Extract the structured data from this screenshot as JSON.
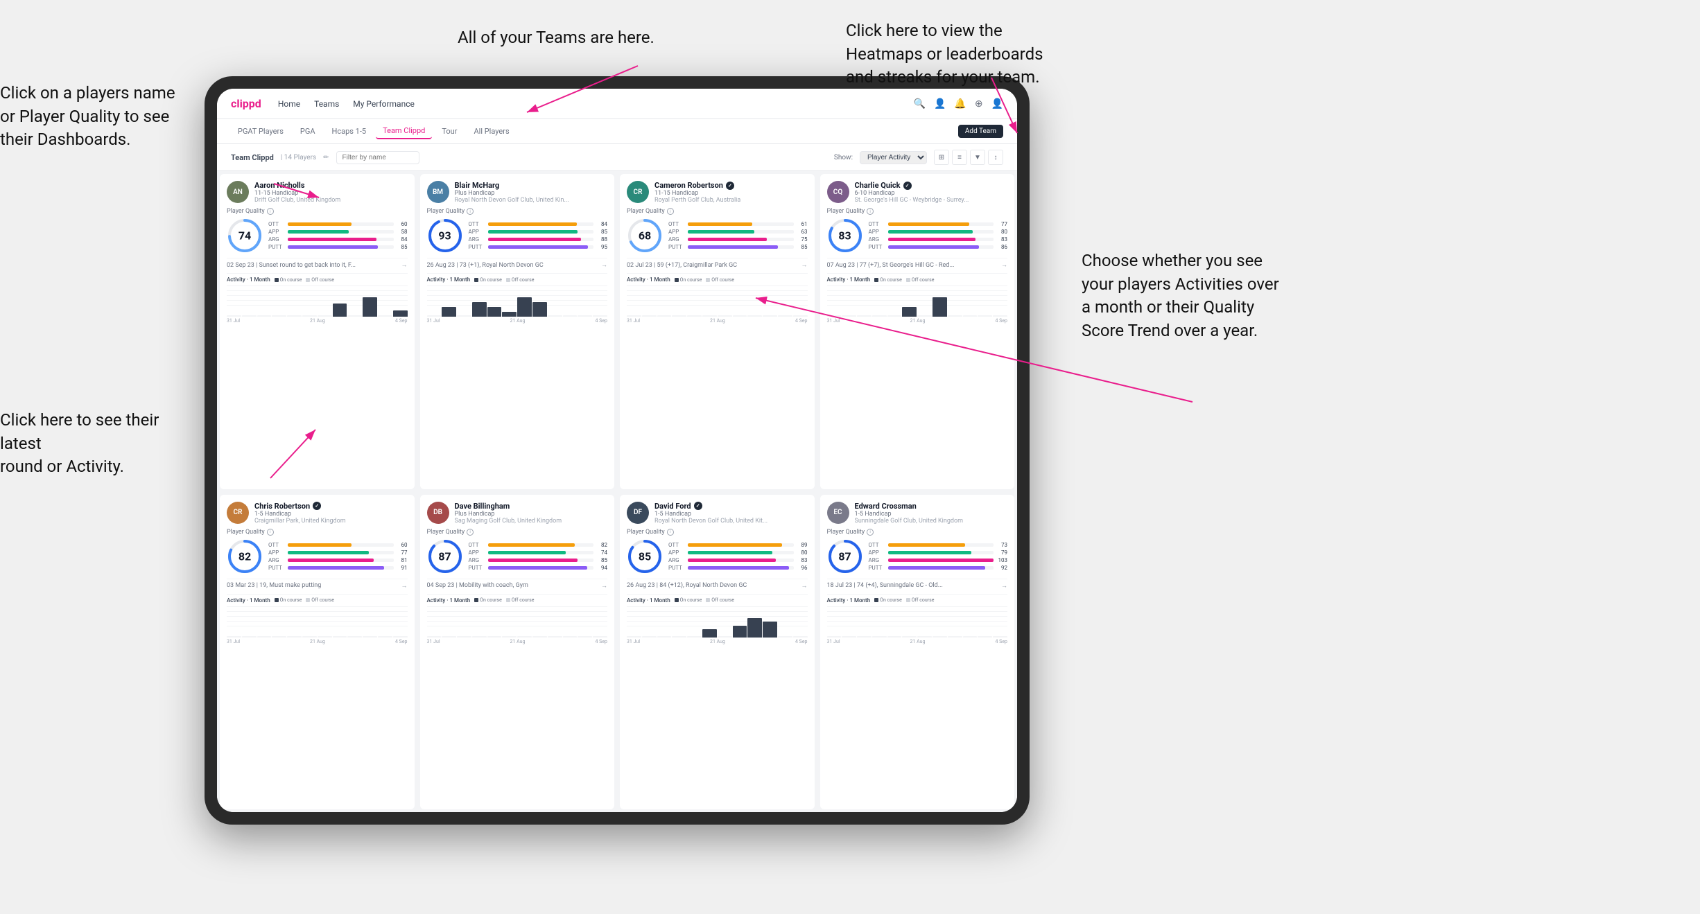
{
  "annotations": {
    "teams_label": "All of your Teams are here.",
    "heatmaps_label": "Click here to view the\nHeatmaps or leaderboards\nand streaks for your team.",
    "player_name_label": "Click on a players name\nor Player Quality to see\ntheir Dashboards.",
    "latest_round_label": "Click here to see their latest\nround or Activity.",
    "activity_label": "Choose whether you see\nyour players Activities over\na month or their Quality\nScore Trend over a year."
  },
  "nav": {
    "logo": "clippd",
    "links": [
      "Home",
      "Teams",
      "My Performance"
    ],
    "icons": [
      "🔍",
      "👤",
      "🔔",
      "⊕",
      "👤"
    ]
  },
  "sub_tabs": [
    "PGAT Players",
    "PGA",
    "Hcaps 1-5",
    "Team Clippd",
    "Tour",
    "All Players"
  ],
  "active_tab": "Team Clippd",
  "add_team": "Add Team",
  "team_header": {
    "title": "Team Clippd",
    "count": "14 Players",
    "edit_icon": "✏",
    "filter_placeholder": "Filter by name",
    "show_label": "Show:",
    "show_value": "Player Activity"
  },
  "players": [
    {
      "name": "Aaron Nicholls",
      "handicap": "11-15 Handicap",
      "club": "Drift Golf Club, United Kingdom",
      "quality": 74,
      "ott": 60,
      "app": 58,
      "arg": 84,
      "putt": 85,
      "latest_round": "02 Sep 23 | Sunset round to get back into it, F...",
      "avatar_color": "avatar-green",
      "avatar_initials": "AN",
      "bars_color": {
        "ott": "#f59e0b",
        "app": "#10b981",
        "arg": "#e91e8c",
        "putt": "#8b5cf6"
      },
      "chart_bars": [
        0,
        0,
        0,
        0,
        0,
        0,
        0,
        2,
        0,
        3,
        0,
        1
      ],
      "chart_labels": [
        "31 Jul",
        "21 Aug",
        "4 Sep"
      ]
    },
    {
      "name": "Blair McHarg",
      "handicap": "Plus Handicap",
      "club": "Royal North Devon Golf Club, United Kin...",
      "quality": 93,
      "ott": 84,
      "app": 85,
      "arg": 88,
      "putt": 95,
      "latest_round": "26 Aug 23 | 73 (+1), Royal North Devon GC",
      "avatar_color": "avatar-blue",
      "avatar_initials": "BM",
      "bars_color": {
        "ott": "#f59e0b",
        "app": "#10b981",
        "arg": "#e91e8c",
        "putt": "#8b5cf6"
      },
      "chart_bars": [
        0,
        2,
        0,
        3,
        2,
        1,
        4,
        3,
        0,
        0,
        0,
        0
      ],
      "chart_labels": [
        "31 Jul",
        "21 Aug",
        "4 Sep"
      ]
    },
    {
      "name": "Cameron Robertson",
      "handicap": "11-15 Handicap",
      "club": "Royal Perth Golf Club, Australia",
      "quality": 68,
      "ott": 61,
      "app": 63,
      "arg": 75,
      "putt": 85,
      "latest_round": "02 Jul 23 | 59 (+17), Craigmillar Park GC",
      "avatar_color": "avatar-teal",
      "avatar_initials": "CR",
      "has_badge": true,
      "bars_color": {
        "ott": "#f59e0b",
        "app": "#10b981",
        "arg": "#e91e8c",
        "putt": "#8b5cf6"
      },
      "chart_bars": [
        0,
        0,
        0,
        0,
        0,
        0,
        0,
        0,
        0,
        0,
        0,
        0
      ],
      "chart_labels": [
        "31 Jul",
        "21 Aug",
        "4 Sep"
      ]
    },
    {
      "name": "Charlie Quick",
      "handicap": "6-10 Handicap",
      "club": "St. George's Hill GC - Weybridge - Surrey...",
      "quality": 83,
      "ott": 77,
      "app": 80,
      "arg": 83,
      "putt": 86,
      "latest_round": "07 Aug 23 | 77 (+7), St George's Hill GC - Red...",
      "avatar_color": "avatar-purple",
      "avatar_initials": "CQ",
      "has_badge": true,
      "bars_color": {
        "ott": "#f59e0b",
        "app": "#10b981",
        "arg": "#e91e8c",
        "putt": "#8b5cf6"
      },
      "chart_bars": [
        0,
        0,
        0,
        0,
        0,
        1,
        0,
        2,
        0,
        0,
        0,
        0
      ],
      "chart_labels": [
        "31 Jul",
        "21 Aug",
        "4 Sep"
      ]
    },
    {
      "name": "Chris Robertson",
      "handicap": "1-5 Handicap",
      "club": "Craigmillar Park, United Kingdom",
      "quality": 82,
      "ott": 60,
      "app": 77,
      "arg": 81,
      "putt": 91,
      "latest_round": "03 Mar 23 | 19, Must make putting",
      "avatar_color": "avatar-orange",
      "avatar_initials": "CR",
      "has_badge": true,
      "bars_color": {
        "ott": "#f59e0b",
        "app": "#10b981",
        "arg": "#e91e8c",
        "putt": "#8b5cf6"
      },
      "chart_bars": [
        0,
        0,
        0,
        0,
        0,
        0,
        0,
        0,
        0,
        0,
        0,
        0
      ],
      "chart_labels": [
        "31 Jul",
        "21 Aug",
        "4 Sep"
      ]
    },
    {
      "name": "Dave Billingham",
      "handicap": "Plus Handicap",
      "club": "Sag Maging Golf Club, United Kingdom",
      "quality": 87,
      "ott": 82,
      "app": 74,
      "arg": 85,
      "putt": 94,
      "latest_round": "04 Sep 23 | Mobility with coach, Gym",
      "avatar_color": "avatar-red",
      "avatar_initials": "DB",
      "bars_color": {
        "ott": "#f59e0b",
        "app": "#10b981",
        "arg": "#e91e8c",
        "putt": "#8b5cf6"
      },
      "chart_bars": [
        0,
        0,
        0,
        0,
        0,
        0,
        0,
        0,
        0,
        0,
        0,
        0
      ],
      "chart_labels": [
        "31 Jul",
        "21 Aug",
        "4 Sep"
      ]
    },
    {
      "name": "David Ford",
      "handicap": "1-5 Handicap",
      "club": "Royal North Devon Golf Club, United Kit...",
      "quality": 85,
      "ott": 89,
      "app": 80,
      "arg": 83,
      "putt": 96,
      "latest_round": "26 Aug 23 | 84 (+12), Royal North Devon GC",
      "avatar_color": "avatar-dark",
      "avatar_initials": "DF",
      "has_badge": true,
      "bars_color": {
        "ott": "#f59e0b",
        "app": "#10b981",
        "arg": "#e91e8c",
        "putt": "#8b5cf6"
      },
      "chart_bars": [
        0,
        0,
        0,
        0,
        0,
        2,
        0,
        3,
        5,
        4,
        0,
        0
      ],
      "chart_labels": [
        "31 Jul",
        "21 Aug",
        "4 Sep"
      ]
    },
    {
      "name": "Edward Crossman",
      "handicap": "1-5 Handicap",
      "club": "Sunningdale Golf Club, United Kingdom",
      "quality": 87,
      "ott": 73,
      "app": 79,
      "arg": 103,
      "putt": 92,
      "latest_round": "18 Jul 23 | 74 (+4), Sunningdale GC - Old...",
      "avatar_color": "avatar-gray",
      "avatar_initials": "EC",
      "bars_color": {
        "ott": "#f59e0b",
        "app": "#10b981",
        "arg": "#e91e8c",
        "putt": "#8b5cf6"
      },
      "chart_bars": [
        0,
        0,
        0,
        0,
        0,
        0,
        0,
        0,
        0,
        0,
        0,
        0
      ],
      "chart_labels": [
        "31 Jul",
        "21 Aug",
        "4 Sep"
      ]
    }
  ],
  "activity_header": "Activity · 1 Month",
  "on_course_label": "On course",
  "off_course_label": "Off course",
  "on_course_color": "#374151",
  "off_course_color": "#d1d5db"
}
